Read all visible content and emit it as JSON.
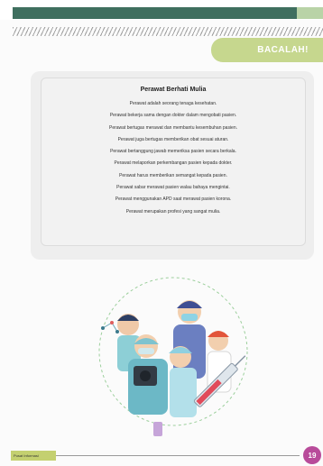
{
  "header": {
    "tab_label": "BACALAH!"
  },
  "reading": {
    "title": "Perawat Berhati Mulia",
    "lines": [
      "Perawat adalah seorang tenaga kesehatan.",
      "Perawat bekerja sama dengan dokter dalam mengobati pasien.",
      "Perawat bertugas merawat dan membantu kesembuhan pasien.",
      "Perawat juga bertugas memberikan obat sesuai aturan.",
      "Perawat bertanggung jawab memeriksa pasien secara berkala.",
      "Perawat melaporkan perkembangan pasien kepada dokter.",
      "Perawat harus memberikan semangat kepada pasien.",
      "Perawat sabar merawat pasien walau bahaya mengintai.",
      "Perawat menggunakan APD saat merawat pasien korona.",
      "Perawat merupakan profesi yang sangat mulia."
    ]
  },
  "footer": {
    "book_tag": "Pusat Informasi",
    "page_number": "19"
  },
  "colors": {
    "header_dark": "#3f6f5f",
    "tab_green": "#c6d78e",
    "page_badge": "#b84b9a"
  },
  "illustration": {
    "icon": "health-workers-illustration"
  }
}
